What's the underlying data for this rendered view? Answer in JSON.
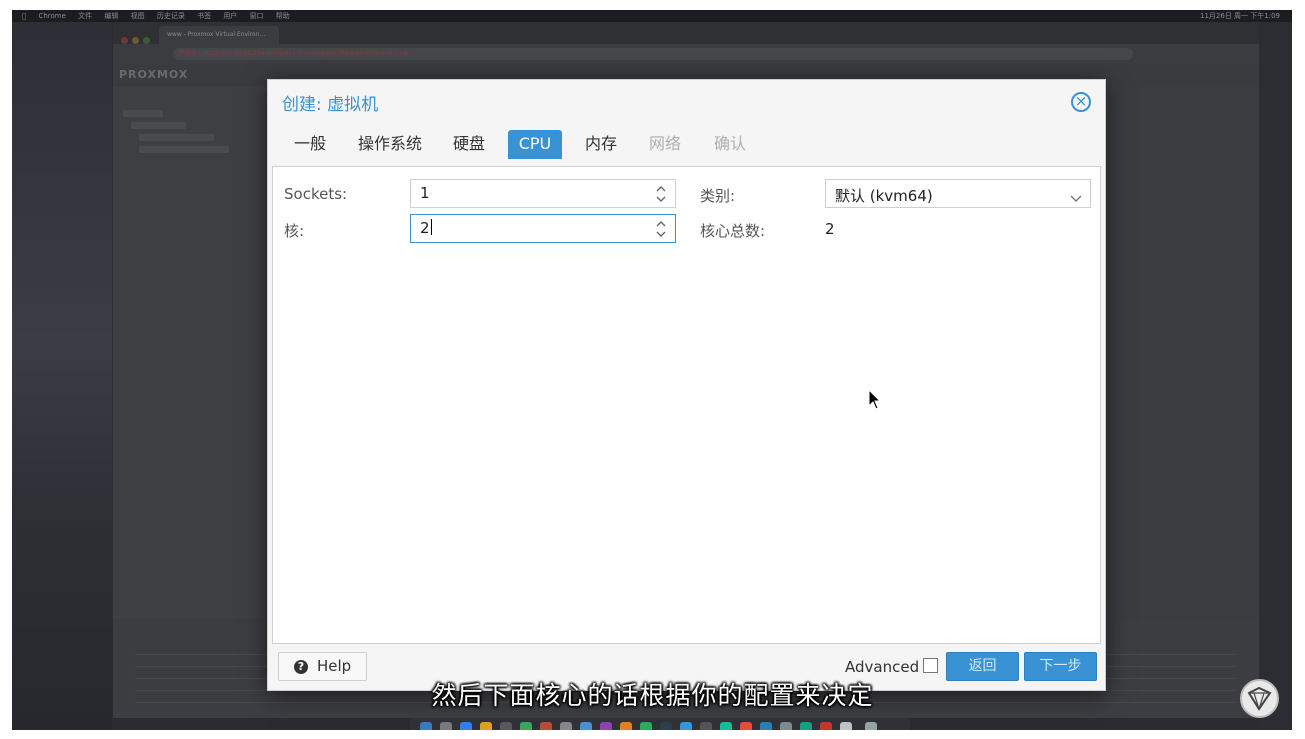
{
  "menubar": {
    "items": [
      "Chrome",
      "文件",
      "编辑",
      "视图",
      "历史记录",
      "书签",
      "用户",
      "窗口",
      "帮助"
    ],
    "status": "11月26日 周一 下午1:09"
  },
  "browser": {
    "tab_title": "www - Proxmox Virtual Environ...",
    "url": "不安全 | https://10.10.10.254:8006/#v1:0:=storage%2Fwww%2Flocal:4:11:8:::"
  },
  "app": {
    "logo": "PROXMOX"
  },
  "dialog": {
    "title": "创建: 虚拟机",
    "tabs": [
      {
        "label": "一般",
        "state": "normal"
      },
      {
        "label": "操作系统",
        "state": "normal"
      },
      {
        "label": "硬盘",
        "state": "normal"
      },
      {
        "label": "CPU",
        "state": "active"
      },
      {
        "label": "内存",
        "state": "normal"
      },
      {
        "label": "网络",
        "state": "disabled"
      },
      {
        "label": "确认",
        "state": "disabled"
      }
    ],
    "cpu": {
      "sockets_label": "Sockets:",
      "sockets_value": "1",
      "cores_label": "核:",
      "cores_value": "2",
      "type_label": "类别:",
      "type_value": "默认 (kvm64)",
      "total_label": "核心总数:",
      "total_value": "2"
    },
    "footer": {
      "help_label": "Help",
      "advanced_label": "Advanced",
      "advanced_checked": false,
      "back_label": "返回",
      "next_label": "下一步"
    }
  },
  "subtitle": "然后下面核心的话根据你的配置来决定",
  "colors": {
    "accent": "#3892d3",
    "dialog_bg": "#f5f5f5",
    "panel_bg": "#ffffff",
    "backdrop": "#2a2c31"
  },
  "icons": {
    "close": "close-circle-icon",
    "help": "question-circle-icon",
    "spinner": "spinner-arrows-icon",
    "dropdown": "chevron-down-icon",
    "cursor": "mouse-pointer-icon"
  }
}
